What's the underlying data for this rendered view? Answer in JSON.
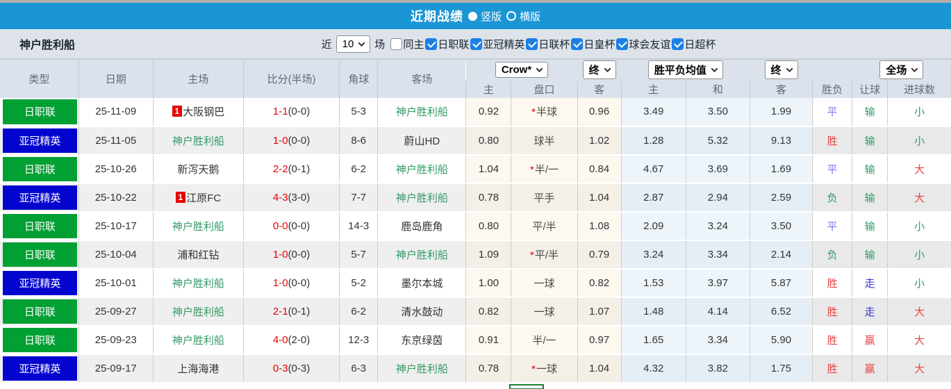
{
  "title_bar": {
    "title": "近期战绩",
    "radios": [
      {
        "label": "竖版",
        "selected": true
      },
      {
        "label": "横版",
        "selected": false
      }
    ]
  },
  "filter_bar": {
    "team": "神户胜利船",
    "recent_label": "近",
    "match_count": "10",
    "matches_label": "场",
    "checkboxes": [
      {
        "label": "同主",
        "checked": false
      },
      {
        "label": "日职联",
        "checked": true
      },
      {
        "label": "亚冠精英",
        "checked": true
      },
      {
        "label": "日联杯",
        "checked": true
      },
      {
        "label": "日皇杯",
        "checked": true
      },
      {
        "label": "球会友谊",
        "checked": true
      },
      {
        "label": "日超杯",
        "checked": true
      }
    ]
  },
  "table": {
    "headers": {
      "type": "类型",
      "date": "日期",
      "home": "主场",
      "score": "比分(半场)",
      "corner": "角球",
      "away": "客场",
      "odds_home": "主",
      "odds_handicap": "盘口",
      "odds_away": "客",
      "avg_home": "主",
      "avg_draw": "和",
      "avg_away": "客",
      "result": "胜负",
      "handicap_result": "让球",
      "goals": "进球数"
    },
    "dropdowns": {
      "bookmaker": "Crow*",
      "odds_time": "终",
      "avg_type": "胜平负均值",
      "avg_time": "终",
      "period": "全场"
    },
    "rows": [
      {
        "league": "日职联",
        "lc": "green",
        "date": "25-11-09",
        "home": "大阪钢巴",
        "home_badge": "1",
        "home_kobe": false,
        "score": "1-1",
        "half": "(0-0)",
        "corners": "5-3",
        "away": "神户胜利船",
        "away_kobe": true,
        "odds": [
          "0.92",
          "*半球",
          "0.96"
        ],
        "avg": [
          "3.49",
          "3.50",
          "1.99"
        ],
        "result": {
          "t": "平",
          "c": "blue"
        },
        "hres": {
          "t": "输",
          "c": "green"
        },
        "goals": {
          "t": "小",
          "c": "green"
        }
      },
      {
        "league": "亚冠精英",
        "lc": "blue",
        "date": "25-11-05",
        "home": "神户胜利船",
        "home_badge": "",
        "home_kobe": true,
        "score": "1-0",
        "half": "(0-0)",
        "corners": "8-6",
        "away": "蔚山HD",
        "away_kobe": false,
        "odds": [
          "0.80",
          "球半",
          "1.02"
        ],
        "avg": [
          "1.28",
          "5.32",
          "9.13"
        ],
        "result": {
          "t": "胜",
          "c": "red"
        },
        "hres": {
          "t": "输",
          "c": "green"
        },
        "goals": {
          "t": "小",
          "c": "green"
        }
      },
      {
        "league": "日职联",
        "lc": "green",
        "date": "25-10-26",
        "home": "新泻天鹅",
        "home_badge": "",
        "home_kobe": false,
        "score": "2-2",
        "half": "(0-1)",
        "corners": "6-2",
        "away": "神户胜利船",
        "away_kobe": true,
        "odds": [
          "1.04",
          "*半/一",
          "0.84"
        ],
        "avg": [
          "4.67",
          "3.69",
          "1.69"
        ],
        "result": {
          "t": "平",
          "c": "blue"
        },
        "hres": {
          "t": "输",
          "c": "green"
        },
        "goals": {
          "t": "大",
          "c": "red"
        }
      },
      {
        "league": "亚冠精英",
        "lc": "blue",
        "date": "25-10-22",
        "home": "江原FC",
        "home_badge": "1",
        "home_kobe": false,
        "score": "4-3",
        "half": "(3-0)",
        "corners": "7-7",
        "away": "神户胜利船",
        "away_kobe": true,
        "odds": [
          "0.78",
          "平手",
          "1.04"
        ],
        "avg": [
          "2.87",
          "2.94",
          "2.59"
        ],
        "result": {
          "t": "负",
          "c": "green"
        },
        "hres": {
          "t": "输",
          "c": "green"
        },
        "goals": {
          "t": "大",
          "c": "red"
        }
      },
      {
        "league": "日职联",
        "lc": "green",
        "date": "25-10-17",
        "home": "神户胜利船",
        "home_badge": "",
        "home_kobe": true,
        "score": "0-0",
        "half": "(0-0)",
        "corners": "14-3",
        "away": "鹿岛鹿角",
        "away_kobe": false,
        "odds": [
          "0.80",
          "平/半",
          "1.08"
        ],
        "avg": [
          "2.09",
          "3.24",
          "3.50"
        ],
        "result": {
          "t": "平",
          "c": "blue"
        },
        "hres": {
          "t": "输",
          "c": "green"
        },
        "goals": {
          "t": "小",
          "c": "green"
        }
      },
      {
        "league": "日职联",
        "lc": "green",
        "date": "25-10-04",
        "home": "浦和红钻",
        "home_badge": "",
        "home_kobe": false,
        "score": "1-0",
        "half": "(0-0)",
        "corners": "5-7",
        "away": "神户胜利船",
        "away_kobe": true,
        "odds": [
          "1.09",
          "*平/半",
          "0.79"
        ],
        "avg": [
          "3.24",
          "3.34",
          "2.14"
        ],
        "result": {
          "t": "负",
          "c": "green"
        },
        "hres": {
          "t": "输",
          "c": "green"
        },
        "goals": {
          "t": "小",
          "c": "green"
        }
      },
      {
        "league": "亚冠精英",
        "lc": "blue",
        "date": "25-10-01",
        "home": "神户胜利船",
        "home_badge": "",
        "home_kobe": true,
        "score": "1-0",
        "half": "(0-0)",
        "corners": "5-2",
        "away": "墨尔本城",
        "away_kobe": false,
        "odds": [
          "1.00",
          "一球",
          "0.82"
        ],
        "avg": [
          "1.53",
          "3.97",
          "5.87"
        ],
        "result": {
          "t": "胜",
          "c": "red"
        },
        "hres": {
          "t": "走",
          "c": "dblue"
        },
        "goals": {
          "t": "小",
          "c": "green"
        }
      },
      {
        "league": "日职联",
        "lc": "green",
        "date": "25-09-27",
        "home": "神户胜利船",
        "home_badge": "",
        "home_kobe": true,
        "score": "2-1",
        "half": "(0-1)",
        "corners": "6-2",
        "away": "清水鼓动",
        "away_kobe": false,
        "odds": [
          "0.82",
          "一球",
          "1.07"
        ],
        "avg": [
          "1.48",
          "4.14",
          "6.52"
        ],
        "result": {
          "t": "胜",
          "c": "red"
        },
        "hres": {
          "t": "走",
          "c": "dblue"
        },
        "goals": {
          "t": "大",
          "c": "red"
        }
      },
      {
        "league": "日职联",
        "lc": "green",
        "date": "25-09-23",
        "home": "神户胜利船",
        "home_badge": "",
        "home_kobe": true,
        "score": "4-0",
        "half": "(2-0)",
        "corners": "12-3",
        "away": "东京绿茵",
        "away_kobe": false,
        "odds": [
          "0.91",
          "半/一",
          "0.97"
        ],
        "avg": [
          "1.65",
          "3.34",
          "5.90"
        ],
        "result": {
          "t": "胜",
          "c": "red"
        },
        "hres": {
          "t": "赢",
          "c": "red"
        },
        "goals": {
          "t": "大",
          "c": "red"
        }
      },
      {
        "league": "亚冠精英",
        "lc": "blue",
        "date": "25-09-17",
        "home": "上海海港",
        "home_badge": "",
        "home_kobe": false,
        "score": "0-3",
        "half": "(0-3)",
        "corners": "6-3",
        "away": "神户胜利船",
        "away_kobe": true,
        "odds": [
          "0.78",
          "*一球",
          "1.04"
        ],
        "avg": [
          "4.32",
          "3.82",
          "1.75"
        ],
        "result": {
          "t": "胜",
          "c": "red"
        },
        "hres": {
          "t": "赢",
          "c": "red"
        },
        "goals": {
          "t": "大",
          "c": "red"
        }
      }
    ]
  },
  "colors": {
    "topbar_blue": "#1b96d4",
    "league_green": "#00a033",
    "league_blue": "#0404cf",
    "kobe_team_green": "#339966",
    "score_red": "#e60000",
    "win_red": "#e64444",
    "draw_blue": "#7a7af0",
    "lose_green": "#339966",
    "walk_blue": "#3434d0",
    "checkbox_blue": "#1a80e6",
    "red_card_badge": "#e80000"
  }
}
